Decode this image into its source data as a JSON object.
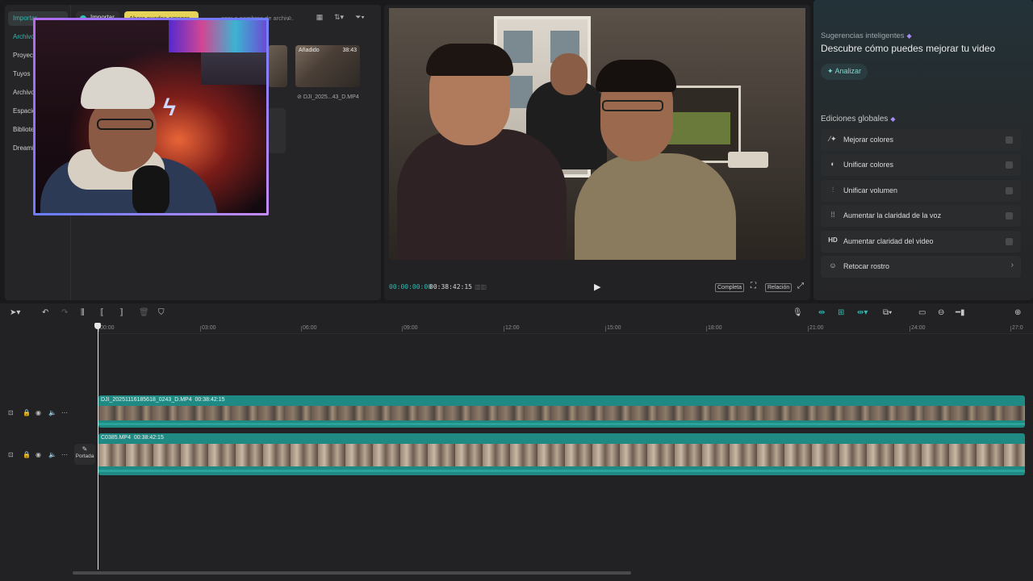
{
  "colors": {
    "accent": "#33b8b0",
    "clip": "#1f8a84",
    "gem": "#a58cf0",
    "tooltip": "#e6d45a"
  },
  "sidebar": {
    "items": [
      {
        "label": "Importar",
        "active": true
      },
      {
        "label": "Archivos"
      },
      {
        "label": "Proyectos"
      },
      {
        "label": "Tuyos"
      },
      {
        "label": "Archivos"
      },
      {
        "label": "Espacios"
      },
      {
        "label": "Biblioteca"
      },
      {
        "label": "Dreamina"
      }
    ]
  },
  "media": {
    "import_label": "Importar",
    "tooltip": "Ahora puedes agregar...",
    "search_placeholder": "...scar o nombres de archiv...",
    "items": [
      {
        "badge": "Añadido",
        "duration": "38:43",
        "name": "DJI_2025...43_D.MP4"
      }
    ]
  },
  "player": {
    "timecode_current": "00:00:00:00",
    "timecode_total": "00:38:42:15",
    "full_label": "Completa",
    "ratio_label": "Relación"
  },
  "right": {
    "suggestions_title": "Sugerencias inteligentes",
    "suggestions_subtitle": "Descubre cómo puedes mejorar tu video",
    "analyze_label": "Analizar",
    "global_title": "Ediciones globales",
    "global_items": [
      {
        "label": "Mejorar colores",
        "icon": "magic-wand-icon"
      },
      {
        "label": "Unificar colores",
        "icon": "palette-icon"
      },
      {
        "label": "Unificar volumen",
        "icon": "sliders-icon"
      },
      {
        "label": "Aumentar la claridad de la voz",
        "icon": "voice-wave-icon"
      },
      {
        "label": "Aumentar claridad del video",
        "icon": "hd-icon"
      },
      {
        "label": "Retocar rostro",
        "icon": "face-retouch-icon"
      }
    ]
  },
  "timeline": {
    "ruler": [
      "00:00",
      "03:00",
      "06:00",
      "09:00",
      "12:00",
      "15:00",
      "18:00",
      "21:00",
      "24:00",
      "27:0"
    ],
    "cover_label": "Portada",
    "tracks": [
      {
        "clip_name": "DJI_20251116185618_0243_D.MP4",
        "clip_duration": "00:38:42:15"
      },
      {
        "clip_name": "C0385.MP4",
        "clip_duration": "00:38:42:15"
      }
    ]
  }
}
